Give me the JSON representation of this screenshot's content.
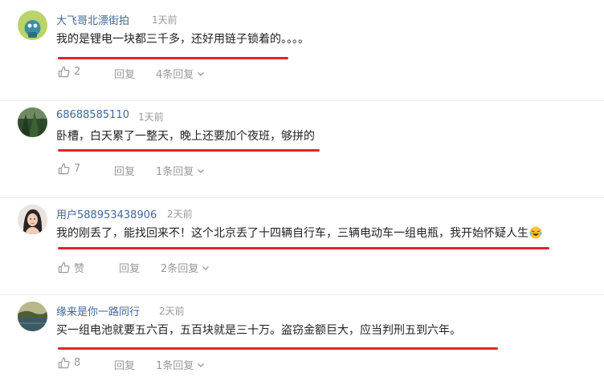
{
  "comments": [
    {
      "username": "大飞哥北漂街拍",
      "time": "1天前",
      "content": "我的是锂电一块都三千多，还好用链子锁着的。。。。",
      "likes": "2",
      "reply_label": "回复",
      "replies_label": "4条回复",
      "avatar_icon": "cartoon-avatar-icon"
    },
    {
      "username": "68688585110",
      "time": "1天前",
      "content": "卧槽，白天累了一整天，晚上还要加个夜班，够拼的",
      "likes": "7",
      "reply_label": "回复",
      "replies_label": "1条回复",
      "avatar_icon": "tree-photo-avatar-icon"
    },
    {
      "username": "用户588953438906",
      "time": "2天前",
      "content": "我的刚丢了，能找回来不！这个北京丢了十四辆自行车，三辆电动车一组电瓶，我开始怀疑人生",
      "likes": "赞",
      "reply_label": "回复",
      "replies_label": "2条回复",
      "avatar_icon": "woman-photo-avatar-icon",
      "emoji_icon": "laughing-crying-emoji-icon"
    },
    {
      "username": "缘来是你一路同行",
      "time": "2天前",
      "content": "买一组电池就要五六百，五百块就是三十万。盗窃金额巨大，应当判刑五到六年。",
      "likes": "8",
      "reply_label": "回复",
      "replies_label": "1条回复",
      "avatar_icon": "landscape-photo-avatar-icon"
    }
  ],
  "colors": {
    "username": "#406599",
    "underline": "#e8202a",
    "meta": "#999999",
    "text": "#222222"
  }
}
